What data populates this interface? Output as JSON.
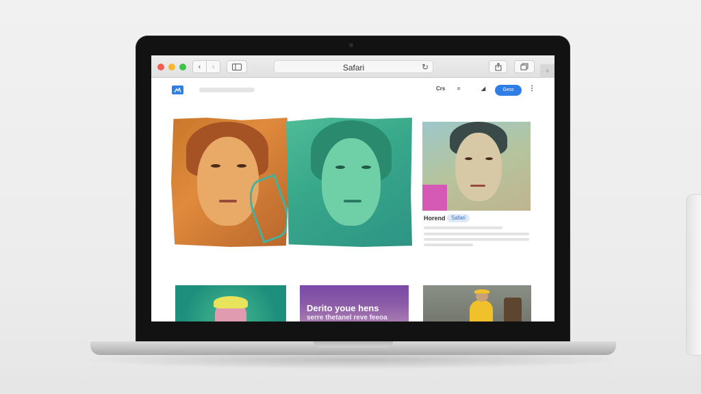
{
  "browser": {
    "address_text": "Safari",
    "back_glyph": "‹",
    "forward_glyph": "›"
  },
  "site_header": {
    "logo_icon": "site-logo-icon",
    "nav_links": [
      "Crs",
      "≈",
      "◢"
    ],
    "cta_label": "Gess",
    "more_glyph": "⋮"
  },
  "cards": {
    "card_3_caption": "Horend",
    "card_3_tag": "Safari",
    "card_5_title": "Derito youe hens",
    "card_5_subtitle": "serre thetanel reve feeoa"
  },
  "colors": {
    "accent": "#2f7ee6",
    "traffic_red": "#f45c52",
    "traffic_yellow": "#f5b82e",
    "traffic_green": "#3cc446"
  }
}
